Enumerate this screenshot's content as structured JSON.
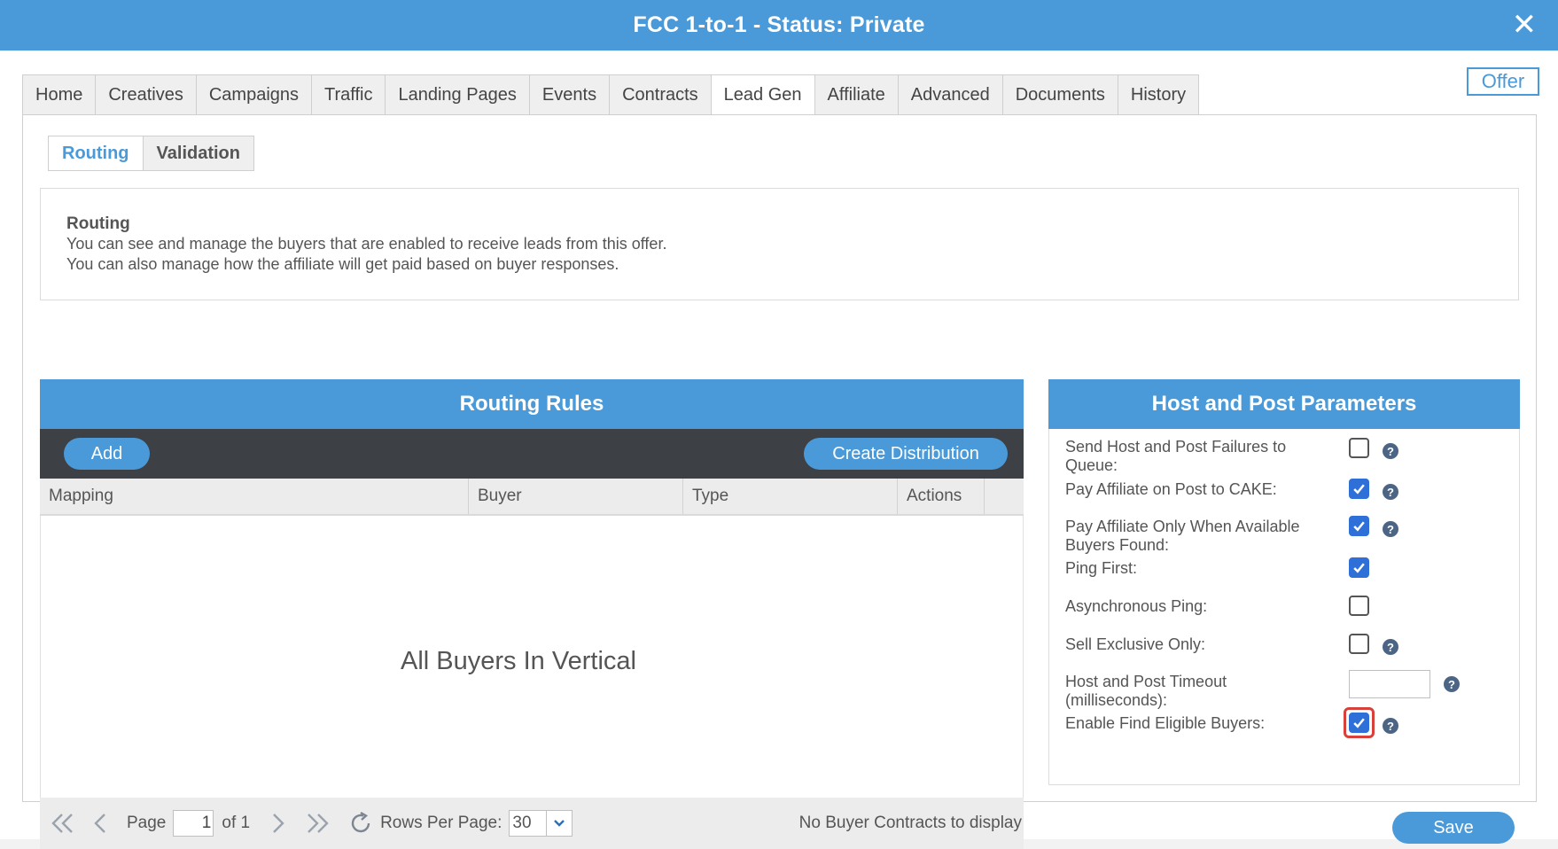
{
  "window": {
    "title": "FCC 1-to-1 - Status: Private",
    "close_label": "✕"
  },
  "offer_label": "Offer",
  "main_tabs": [
    {
      "label": "Home"
    },
    {
      "label": "Creatives"
    },
    {
      "label": "Campaigns"
    },
    {
      "label": "Traffic"
    },
    {
      "label": "Landing Pages"
    },
    {
      "label": "Events"
    },
    {
      "label": "Contracts"
    },
    {
      "label": "Lead Gen",
      "active": true
    },
    {
      "label": "Affiliate"
    },
    {
      "label": "Advanced"
    },
    {
      "label": "Documents"
    },
    {
      "label": "History"
    }
  ],
  "sub_tabs": [
    {
      "label": "Routing",
      "active": true
    },
    {
      "label": "Validation"
    }
  ],
  "info": {
    "title": "Routing",
    "line1": "You can see and manage the buyers that are enabled to receive leads from this offer.",
    "line2": "You can also manage how the affiliate will get paid based on buyer responses."
  },
  "routing_rules": {
    "title": "Routing Rules",
    "add_label": "Add",
    "create_distribution_label": "Create Distribution",
    "columns": [
      "Mapping",
      "Buyer",
      "Type",
      "Actions"
    ],
    "empty_text": "All Buyers In Vertical",
    "pager": {
      "page_label": "Page",
      "page_value": "1",
      "of_label": "of 1",
      "rows_per_page_label": "Rows Per Page:",
      "rows_per_page_value": "30",
      "status_text": "No Buyer Contracts to display"
    }
  },
  "host_post": {
    "title": "Host and Post Parameters",
    "fields": [
      {
        "label": "Send Host and Post Failures to Queue:",
        "checked": false,
        "help": true
      },
      {
        "label": "Pay Affiliate on Post to CAKE:",
        "checked": true,
        "help": true
      },
      {
        "label": "Pay Affiliate Only When Available Buyers Found:",
        "checked": true,
        "help": true
      },
      {
        "label": "Ping First:",
        "checked": true,
        "help": false
      },
      {
        "label": "Asynchronous Ping:",
        "checked": false,
        "help": false
      },
      {
        "label": "Sell Exclusive Only:",
        "checked": false,
        "help": true
      },
      {
        "label": "Host and Post Timeout (milliseconds):",
        "input_value": "",
        "help": true
      },
      {
        "label": "Enable Find Eligible Buyers:",
        "checked": true,
        "help": true,
        "highlighted": true
      }
    ],
    "help_glyph": "?"
  },
  "save_label": "Save",
  "colors": {
    "accent": "#4a9ad9",
    "toolbar": "#3d4045",
    "checkbox": "#2f6fd8",
    "highlight": "#d8413a"
  }
}
